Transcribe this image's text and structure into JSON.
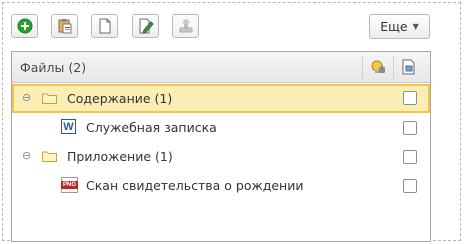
{
  "toolbar": {
    "more_label": "Еще"
  },
  "table": {
    "header_title": "Файлы (2)",
    "rows": [
      {
        "label": "Содержание (1)"
      },
      {
        "label": "Служебная записка"
      },
      {
        "label": "Приложение (1)"
      },
      {
        "label": "Скан свидетельства о рождении"
      }
    ]
  },
  "icons": {
    "w_letter": "W",
    "png_label": "PNG"
  },
  "colors": {
    "selected_row_bg": "#fbeeb5",
    "selected_row_border": "#f4c34d",
    "add_green": "#2aa12f",
    "word_blue": "#2b5797",
    "png_red": "#c0281f"
  }
}
